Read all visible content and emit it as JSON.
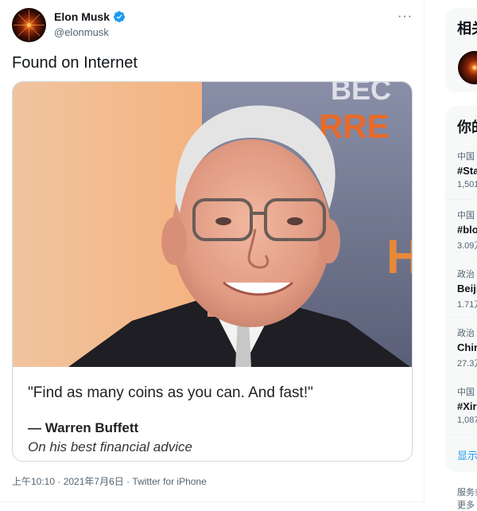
{
  "tweet": {
    "author_name": "Elon Musk",
    "author_handle": "@elonmusk",
    "more_icon": "more-horizontal-icon",
    "verified_icon": "verified-badge-icon",
    "text": "Found on Internet",
    "image": {
      "description_banner_text": "BEC RRE H",
      "quote": "\"Find as many coins as you can. And fast!\"",
      "author": "— Warren Buffett",
      "subnote": "On his best financial advice"
    },
    "timestamp": "上午10:10 · 2021年7月6日 · Twitter for iPhone"
  },
  "sidebar": {
    "section1_title": "相关",
    "section2_title": "你的",
    "trends": [
      {
        "category": "中国",
        "tag": "#Sta",
        "count": "1,501"
      },
      {
        "category": "中国",
        "tag": "#blo",
        "count": "3.09万"
      },
      {
        "category": "政治",
        "tag": "Beiji",
        "count": "1.71万"
      },
      {
        "category": "政治",
        "tag": "Chin",
        "count": "27.3万"
      },
      {
        "category": "中国",
        "tag": "#Xir",
        "count": "1,087"
      }
    ],
    "show_more": "显示",
    "footer_line1": "服务条",
    "footer_line2": "更多"
  },
  "colors": {
    "accent": "#1d9bf0",
    "text_secondary": "#536471",
    "border": "#cfd9de"
  }
}
